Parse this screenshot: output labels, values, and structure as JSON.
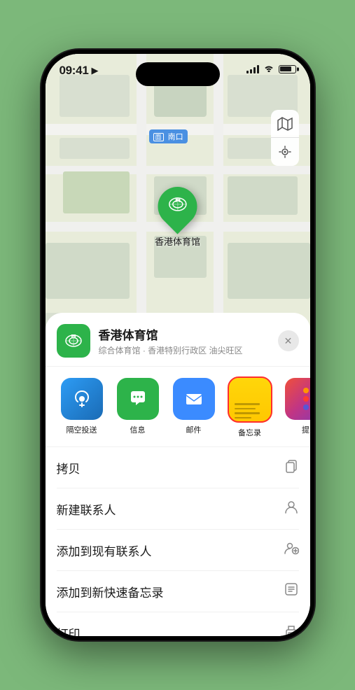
{
  "status_bar": {
    "time": "09:41",
    "location_icon": "▶"
  },
  "map": {
    "label": "南口",
    "label_prefix": "面",
    "marker_label": "香港体育馆",
    "map_btn_map": "🗺",
    "map_btn_location": "➤"
  },
  "venue_header": {
    "name": "香港体育馆",
    "detail": "综合体育馆 · 香港特别行政区 油尖旺区",
    "close_label": "✕"
  },
  "share_items": [
    {
      "id": "airdrop",
      "label": "隔空投送",
      "icon": "📡"
    },
    {
      "id": "messages",
      "label": "信息",
      "icon": "💬"
    },
    {
      "id": "mail",
      "label": "邮件",
      "icon": "✉"
    },
    {
      "id": "notes",
      "label": "备忘录",
      "icon": "notes"
    },
    {
      "id": "more",
      "label": "提",
      "icon": "more"
    }
  ],
  "actions": [
    {
      "id": "copy",
      "label": "拷贝",
      "icon": "⎘"
    },
    {
      "id": "new-contact",
      "label": "新建联系人",
      "icon": "👤"
    },
    {
      "id": "add-contact",
      "label": "添加到现有联系人",
      "icon": "👤+"
    },
    {
      "id": "quick-note",
      "label": "添加到新快速备忘录",
      "icon": "⊡"
    },
    {
      "id": "print",
      "label": "打印",
      "icon": "🖨"
    }
  ]
}
